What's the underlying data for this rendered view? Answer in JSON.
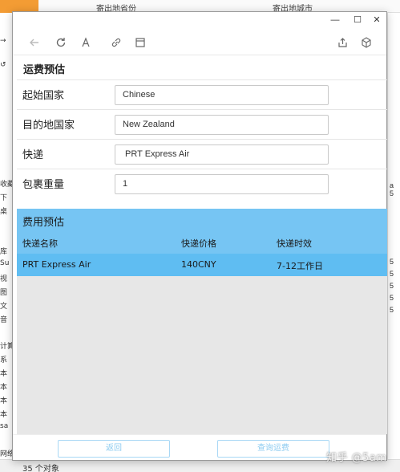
{
  "background": {
    "tabs": [
      "寄出地省份",
      "寄出地城市"
    ],
    "left_items": [
      "→",
      "",
      "↺",
      "收藏",
      "下",
      "桌",
      "",
      "",
      "库",
      "Su",
      "视",
      "图",
      "文",
      "音",
      "",
      "计算",
      "系",
      "本",
      "本",
      "本",
      "本",
      "sa",
      "网络"
    ],
    "right_items": [
      "a",
      "5",
      "5",
      "5",
      "5",
      "5",
      "5"
    ],
    "status": "35 个对象",
    "watermark": "知乎 @5am"
  },
  "window": {
    "controls": {
      "minimize": "—",
      "maximize": "☐",
      "close": "✕"
    },
    "toolbar_icons": [
      "back-arrow-icon",
      "refresh-icon",
      "font-icon",
      "link-icon",
      "window-icon",
      "share-icon",
      "cube-icon"
    ]
  },
  "form": {
    "title": "运费预估",
    "fields": [
      {
        "label": "起始国家",
        "value": "Chinese"
      },
      {
        "label": "目的地国家",
        "value": "New Zealand"
      },
      {
        "label": "快递",
        "value": " PRT Express Air"
      },
      {
        "label": "包裹重量",
        "value": "1"
      }
    ]
  },
  "result": {
    "title": "费用预估",
    "columns": [
      "快递名称",
      "快递价格",
      "快递时效"
    ],
    "rows": [
      [
        "PRT Express Air",
        "140CNY",
        "7-12工作日"
      ]
    ]
  },
  "footer": {
    "back_label": "返回",
    "query_label": "查询运费"
  },
  "colors": {
    "accent": "#76c5f3",
    "accent_row": "#5fbdf2",
    "button_border": "#a9d8f5",
    "bg_orange": "#f39c34"
  }
}
